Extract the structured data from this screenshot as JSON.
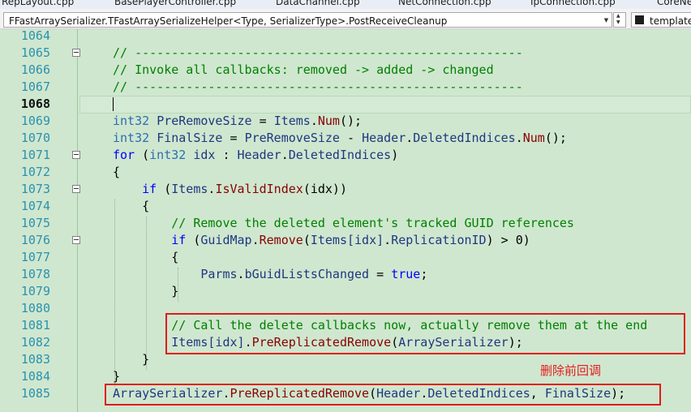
{
  "tabs": [
    {
      "label": "RepLayout.cpp"
    },
    {
      "label": "BasePlayerController.cpp"
    },
    {
      "label": "DataChannel.cpp"
    },
    {
      "label": "NetConnection.cpp"
    },
    {
      "label": "IpConnection.cpp"
    },
    {
      "label": "CoreNe"
    }
  ],
  "navbar": {
    "scope_combo": "FFastArraySerializer.TFastArraySerializeHelper<Type, SerializerType>.PostReceiveCleanup",
    "member_combo": "template"
  },
  "editor": {
    "lines": [
      {
        "num": "1064"
      },
      {
        "num": "1065"
      },
      {
        "num": "1066"
      },
      {
        "num": "1067"
      },
      {
        "num": "1068"
      },
      {
        "num": "1069"
      },
      {
        "num": "1070"
      },
      {
        "num": "1071"
      },
      {
        "num": "1072"
      },
      {
        "num": "1073"
      },
      {
        "num": "1074"
      },
      {
        "num": "1075"
      },
      {
        "num": "1076"
      },
      {
        "num": "1077"
      },
      {
        "num": "1078"
      },
      {
        "num": "1079"
      },
      {
        "num": "1080"
      },
      {
        "num": "1081"
      },
      {
        "num": "1082"
      },
      {
        "num": "1083"
      },
      {
        "num": "1084"
      },
      {
        "num": "1085"
      }
    ],
    "current_line": "1068",
    "tokens": {
      "l1065": "// -----------------------------------------------------",
      "l1066": "// Invoke all callbacks: removed -> added -> changed",
      "l1067": "// -----------------------------------------------------",
      "int32": "int32",
      "preremovesize": "PreRemoveSize",
      "eq": " = ",
      "items": "Items",
      "dot": ".",
      "num": "Num",
      "call_end": "();",
      "finalsize": "FinalSize",
      "minus": " - ",
      "header": "Header",
      "deletedindices": "DeletedIndices",
      "for": "for",
      "open_paren": " (",
      "idx": "idx",
      "colon": " : ",
      "close_paren": ")",
      "open_brace": "{",
      "close_brace": "}",
      "if": "if",
      "isvalidindex": "IsValidIndex",
      "idx_call": "(idx))",
      "l1075": "// Remove the deleted element's tracked GUID references",
      "guidmap": "GuidMap",
      "remove": "Remove",
      "paren": "(",
      "items_idx": "Items[idx]",
      "replicationid": "ReplicationID",
      "gt_zero": ") > 0)",
      "parms": "Parms",
      "bguidlistschanged": "bGuidListsChanged",
      "true": "true",
      "semi": ";",
      "l1081": "// Call the delete callbacks now, actually remove them at the end",
      "prereplicatedremove": "PreReplicatedRemove",
      "arrayserializer": "ArraySerializer",
      "close_semi": ");",
      "comma": ", "
    }
  },
  "annotation": {
    "note": "删除前回调",
    "box_color": "#e01a1a"
  },
  "colors": {
    "editor_background": "#cfe7cf",
    "keyword": "#0000ff",
    "comment": "#008000",
    "member_function": "#880000",
    "line_number": "#2b91af"
  }
}
